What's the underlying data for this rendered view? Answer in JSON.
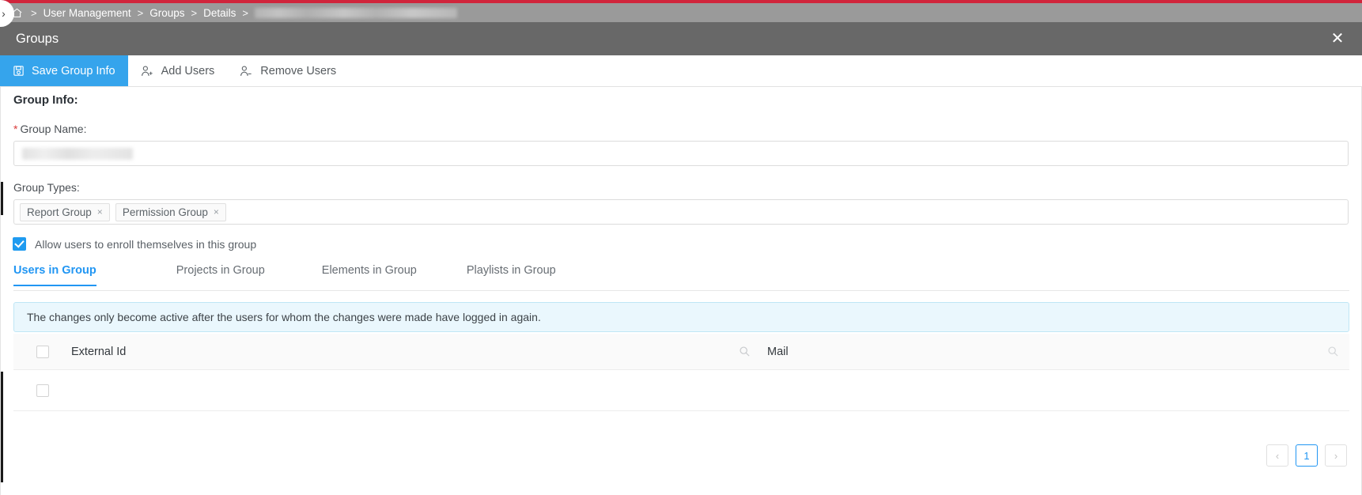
{
  "breadcrumb": {
    "home_icon": "home-icon",
    "separator": ">",
    "items": [
      "User Management",
      "Groups",
      "Details"
    ],
    "redacted_item": ""
  },
  "dialog": {
    "title": "Groups",
    "close_label": "✕"
  },
  "toolbar": {
    "save_label": "Save Group Info",
    "save_icon": "save-disk-icon",
    "add_users_label": "Add Users",
    "add_users_icon": "user-add-icon",
    "remove_users_label": "Remove Users",
    "remove_users_icon": "user-remove-icon",
    "accent_color": "#35a4ec"
  },
  "form": {
    "section_title": "Group Info:",
    "group_name_required_mark": "*",
    "group_name_label": "Group Name:",
    "group_name_value": "",
    "group_types_label": "Group Types:",
    "group_types": [
      {
        "label": "Report Group",
        "remove": "×"
      },
      {
        "label": "Permission Group",
        "remove": "×"
      }
    ],
    "enroll_checkbox_label": "Allow users to enroll themselves in this group",
    "enroll_checked": true
  },
  "tabs": [
    {
      "label": "Users in Group",
      "active": true
    },
    {
      "label": "Projects in Group",
      "active": false
    },
    {
      "label": "Elements in Group",
      "active": false
    },
    {
      "label": "Playlists in Group",
      "active": false
    }
  ],
  "banner": {
    "text": "The changes only become active after the users for whom the changes were made have logged in again."
  },
  "table": {
    "columns": [
      "External Id",
      "Mail"
    ],
    "search_icon": "search-icon",
    "rows": [
      {
        "external_id": "",
        "mail": ""
      }
    ]
  },
  "pagination": {
    "prev": "‹",
    "pages": [
      "1"
    ],
    "next": "›",
    "current": "1",
    "accent_color": "#2196f3"
  }
}
